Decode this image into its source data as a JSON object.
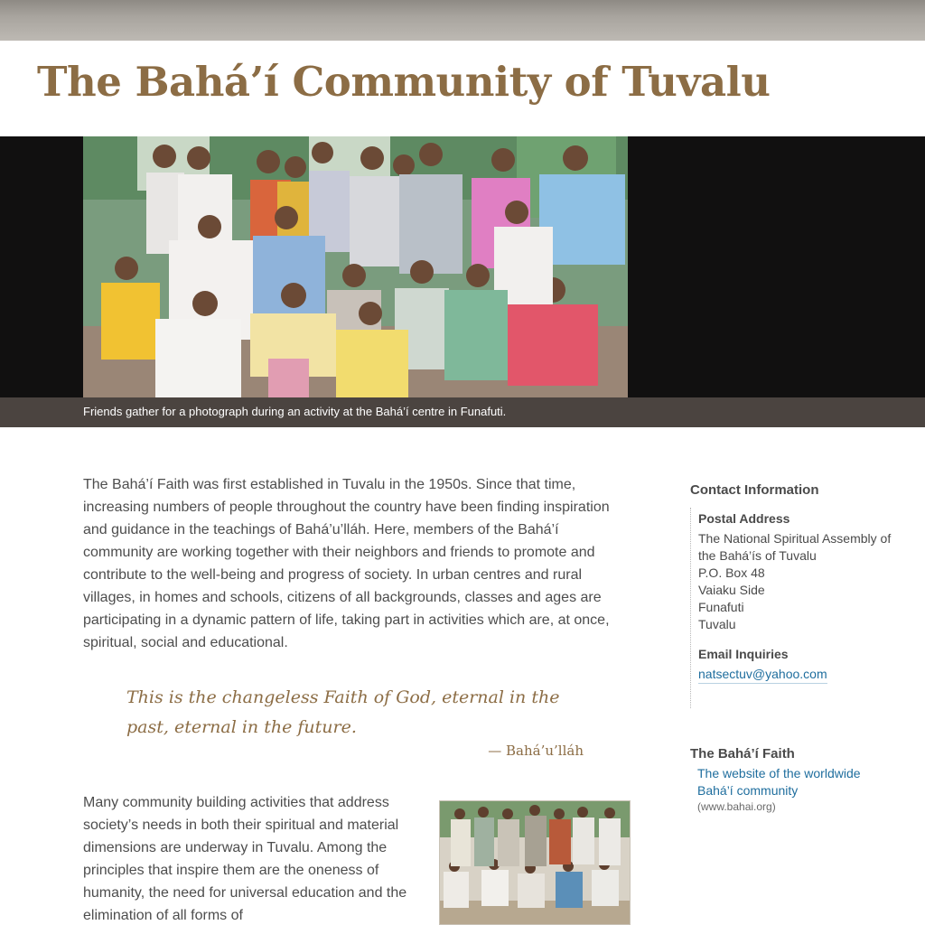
{
  "header": {
    "site_title": "The Bahá’í Community of Tuvalu"
  },
  "hero": {
    "caption": "Friends gather for a photograph during an activity at the Bahá’í centre in Funafuti."
  },
  "main": {
    "intro_paragraph": "The Bahá’í Faith was first established in Tuvalu in the 1950s. Since that time, increasing numbers of people throughout the country have been finding inspiration and guidance in the teachings of Bahá’u’lláh. Here, members of the Bahá’í community are working together with their neighbors and friends to promote and contribute to the well-being and progress of society. In urban centres and rural villages, in homes and schools, citizens of all backgrounds, classes and ages are participating in a dynamic pattern of life, taking part in activities which are, at once, spiritual, social and educational.",
    "quote_text": "This is the changeless Faith of God, eternal in the past, eternal in the future.",
    "quote_author": "— Bahá’u’lláh",
    "second_paragraph": "Many community building activities that address society’s needs in both their spiritual and material dimensions are underway in Tuvalu. Among the principles that inspire them are the oneness of humanity, the need for universal education and the elimination of all forms of"
  },
  "sidebar": {
    "contact_heading": "Contact Information",
    "postal_label": "Postal Address",
    "address_lines": [
      "The National Spiritual Assembly of",
      "the Bahá’ís of Tuvalu",
      "P.O. Box 48",
      "Vaiaku Side",
      "Funafuti",
      "Tuvalu"
    ],
    "email_label": "Email Inquiries",
    "email": "natsectuv@yahoo.com",
    "faith_heading": "The Bahá’í Faith",
    "faith_link": "The website of the worldwide Bahá’í community",
    "faith_url": "(www.bahai.org)"
  },
  "colors": {
    "title_brown": "#8c6d45",
    "link_blue": "#1f6e9e",
    "caption_bar": "#4b4440",
    "hero_band": "#111010"
  }
}
